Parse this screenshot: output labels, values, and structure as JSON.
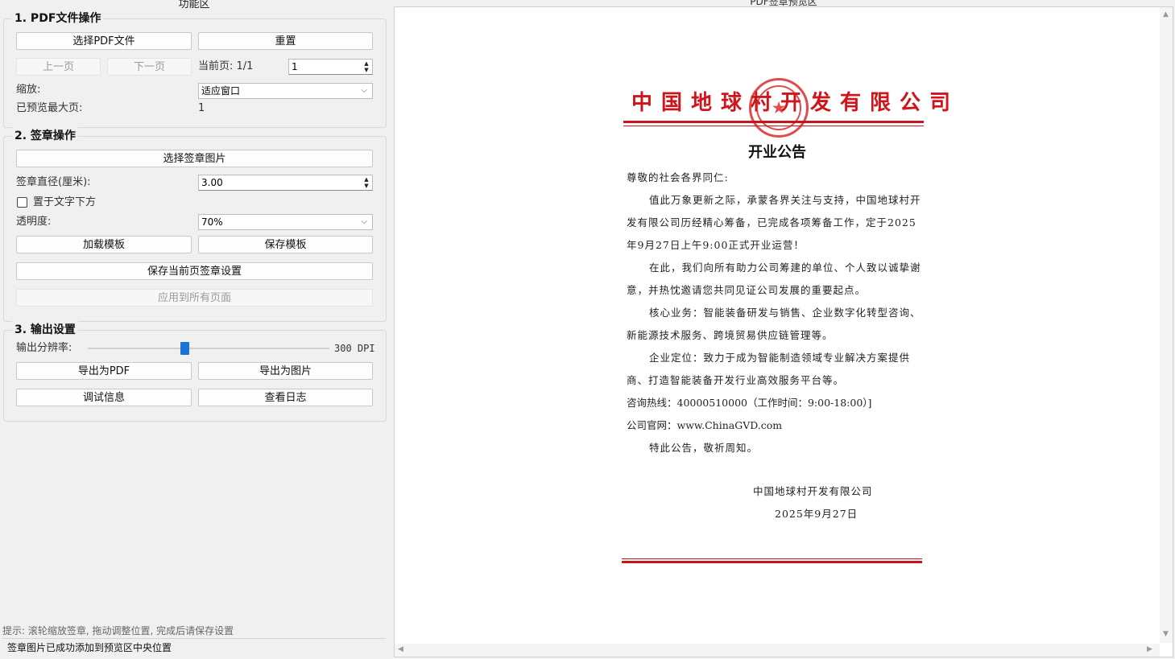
{
  "left_panel": {
    "title": "功能区"
  },
  "pdf_group": {
    "title": "1. PDF文件操作",
    "select_pdf": "选择PDF文件",
    "reset": "重置",
    "prev_page": "上一页",
    "next_page": "下一页",
    "current_page_label": "当前页: 1/1",
    "page_input": "1",
    "zoom_label": "缩放:",
    "zoom_value": "适应窗口",
    "max_preview_label": "已预览最大页:",
    "max_preview_value": "1"
  },
  "stamp_group": {
    "title": "2. 签章操作",
    "select_image": "选择签章图片",
    "diameter_label": "签章直径(厘米):",
    "diameter_value": "3.00",
    "below_text_label": "置于文字下方",
    "opacity_label": "透明度:",
    "opacity_value": "70%",
    "load_template": "加载模板",
    "save_template": "保存模板",
    "save_page_settings": "保存当前页签章设置",
    "apply_all": "应用到所有页面"
  },
  "output_group": {
    "title": "3. 输出设置",
    "resolution_label": "输出分辨率:",
    "resolution_value": "300 DPI",
    "resolution_fraction": 0.4,
    "export_pdf": "导出为PDF",
    "export_image": "导出为图片",
    "debug_info": "调试信息",
    "view_log": "查看日志"
  },
  "hint": "提示: 滚轮缩放签章, 拖动调整位置, 完成后请保存设置",
  "status": "签章图片已成功添加到预览区中央位置",
  "preview": {
    "title": "PDF签章预览区",
    "company": "中国地球村开发有限公司",
    "doc_title": "开业公告",
    "greeting": "尊敬的社会各界同仁:",
    "p1": "值此万象更新之际，承蒙各界关注与支持，中国地球村开发有限公司历经精心筹备，已完成各项筹备工作，定于2025年9月27日上午9:00正式开业运营！",
    "p2": "在此，我们向所有助力公司筹建的单位、个人致以诚挚谢意，并热忱邀请您共同见证公司发展的重要起点。",
    "p3": "核心业务：智能装备研发与销售、企业数字化转型咨询、新能源技术服务、跨境贸易供应链管理等。",
    "p4": "企业定位：致力于成为智能制造领域专业解决方案提供商、打造智能装备开发行业高效服务平台等。",
    "hotline": "咨询热线：40000510000（工作时间：9:00-18:00）]",
    "website": "公司官网：www.ChinaGVD.com",
    "closing": "特此公告，敬祈周知。",
    "signature": "中国地球村开发有限公司",
    "date": "2025年9月27日"
  }
}
